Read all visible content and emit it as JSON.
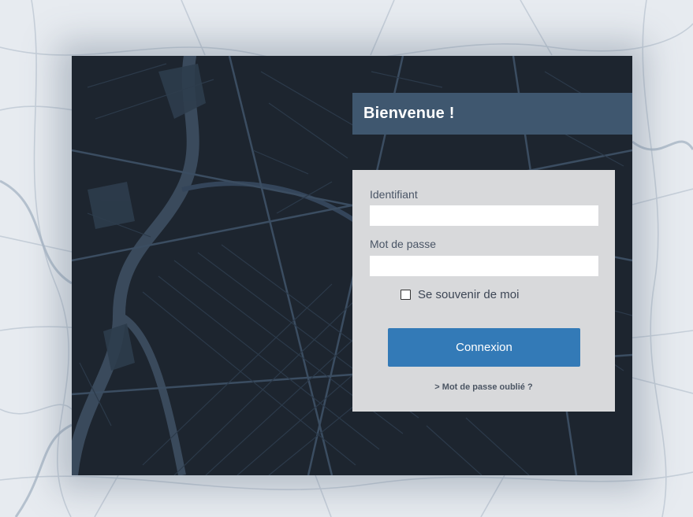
{
  "welcome": {
    "title": "Bienvenue !"
  },
  "login": {
    "username_label": "Identifiant",
    "username_value": "",
    "password_label": "Mot de passe",
    "password_value": "",
    "remember_label": "Se souvenir de moi",
    "remember_checked": false,
    "submit_label": "Connexion",
    "forgot_label": "> Mot de passe oublié ?"
  },
  "colors": {
    "page_background": "#e7ebf0",
    "panel_background": "#1d252f",
    "welcome_bar": "#3f576f",
    "form_background": "#d8d9db",
    "button": "#337ab7",
    "map_lines_light": "#c3ccd7",
    "map_lines_dark": "#3a4a5c"
  }
}
